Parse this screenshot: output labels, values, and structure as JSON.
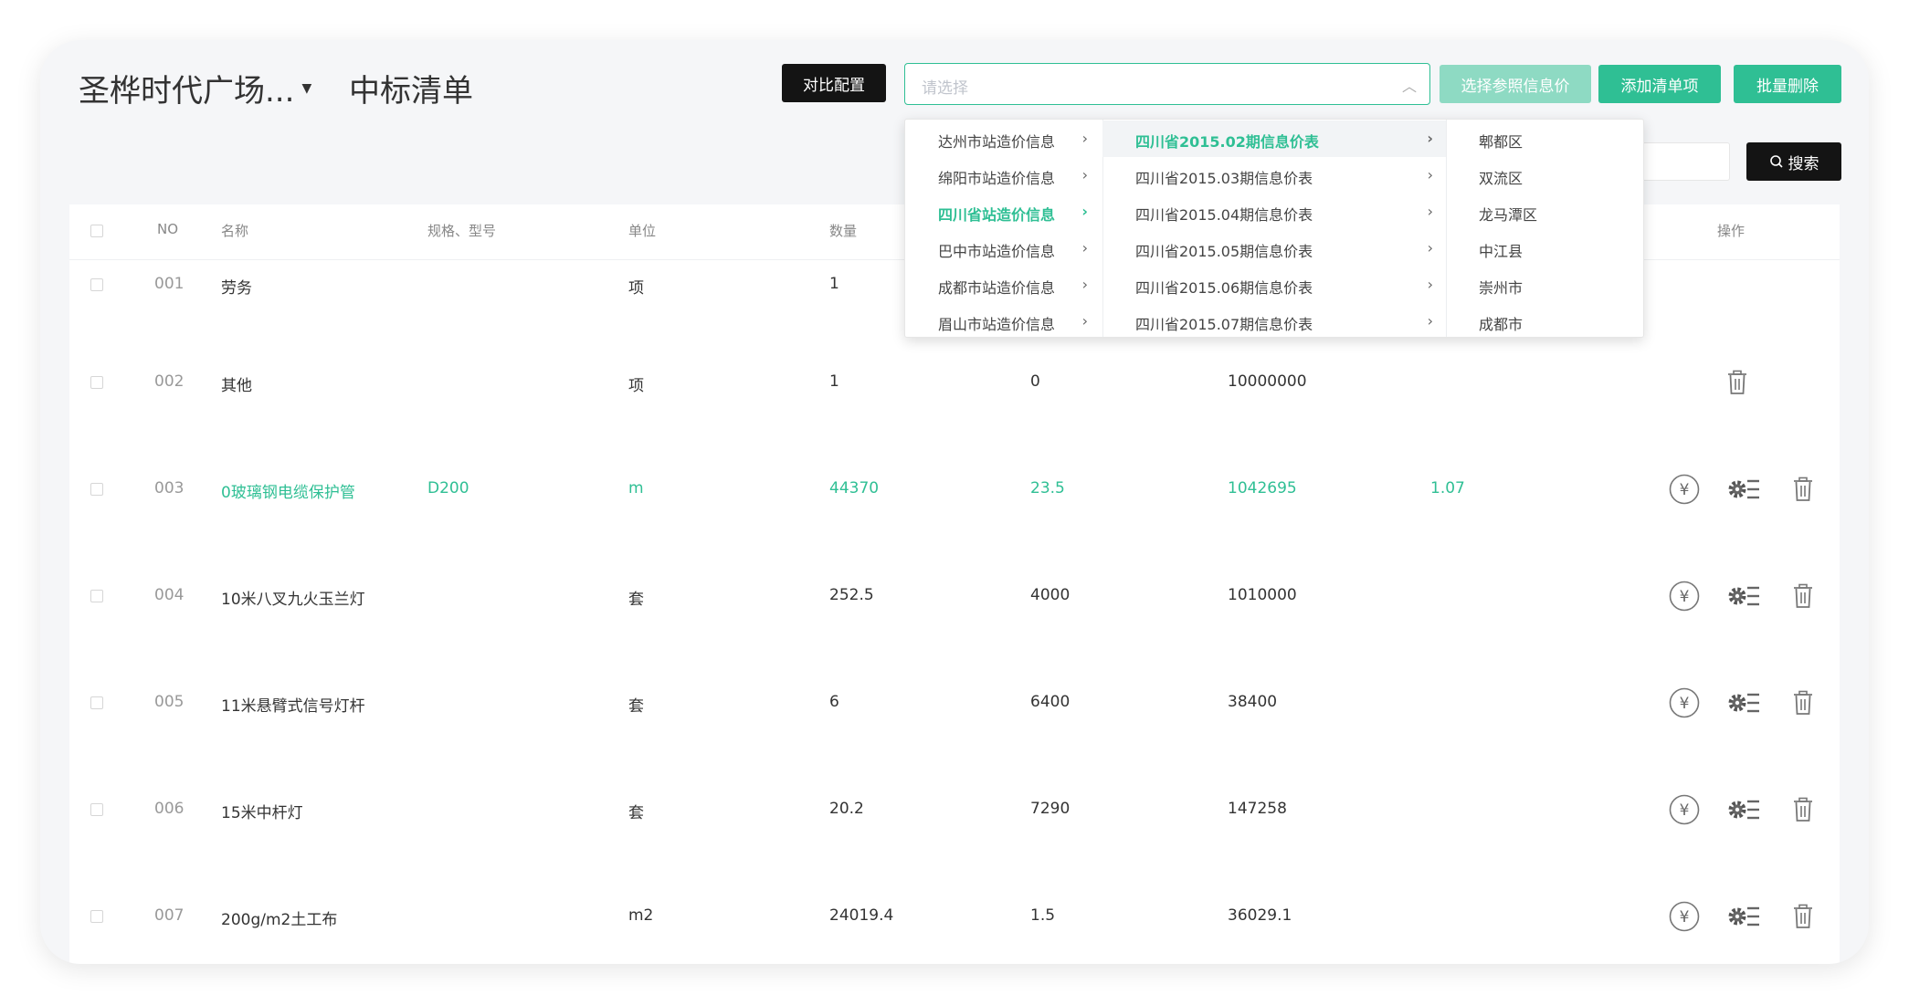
{
  "header": {
    "project_name": "圣桦时代广场...",
    "page_title": "中标清单"
  },
  "toolbar": {
    "compare_button": "对比配置",
    "select_placeholder": "请选择",
    "ref_price_button": "选择参照信息价",
    "add_item_button": "添加清单项",
    "batch_delete_button": "批量删除",
    "search_button": "搜索"
  },
  "table": {
    "columns": {
      "no": "NO",
      "name": "名称",
      "spec": "规格、型号",
      "unit": "单位",
      "qty": "数量",
      "ops": "操作"
    },
    "rows": [
      {
        "no": "001",
        "name": "劳务",
        "spec": "",
        "unit": "项",
        "qty": "1",
        "price": "",
        "total": "",
        "ratio": ""
      },
      {
        "no": "002",
        "name": "其他",
        "spec": "",
        "unit": "项",
        "qty": "1",
        "price": "0",
        "total": "10000000",
        "ratio": ""
      },
      {
        "no": "003",
        "name": "0玻璃钢电缆保护管",
        "spec": "D200",
        "unit": "m",
        "qty": "44370",
        "price": "23.5",
        "total": "1042695",
        "ratio": "1.07"
      },
      {
        "no": "004",
        "name": "10米八叉九火玉兰灯",
        "spec": "",
        "unit": "套",
        "qty": "252.5",
        "price": "4000",
        "total": "1010000",
        "ratio": ""
      },
      {
        "no": "005",
        "name": "11米悬臂式信号灯杆",
        "spec": "",
        "unit": "套",
        "qty": "6",
        "price": "6400",
        "total": "38400",
        "ratio": ""
      },
      {
        "no": "006",
        "name": "15米中杆灯",
        "spec": "",
        "unit": "套",
        "qty": "20.2",
        "price": "7290",
        "total": "147258",
        "ratio": ""
      },
      {
        "no": "007",
        "name": "200g/m2土工布",
        "spec": "",
        "unit": "m2",
        "qty": "24019.4",
        "price": "1.5",
        "total": "36029.1",
        "ratio": ""
      }
    ]
  },
  "cascader": {
    "col1": [
      "达州市站造价信息",
      "绵阳市站造价信息",
      "四川省站造价信息",
      "巴中市站造价信息",
      "成都市站造价信息",
      "眉山市站造价信息"
    ],
    "col2": [
      "四川省2015.02期信息价表",
      "四川省2015.03期信息价表",
      "四川省2015.04期信息价表",
      "四川省2015.05期信息价表",
      "四川省2015.06期信息价表",
      "四川省2015.07期信息价表"
    ],
    "col3": [
      "郫都区",
      "双流区",
      "龙马潭区",
      "中江县",
      "崇州市",
      "成都市"
    ]
  },
  "colors": {
    "accent": "#2fbf94",
    "accent_disabled": "#8edac3",
    "dark_button": "#141414"
  }
}
